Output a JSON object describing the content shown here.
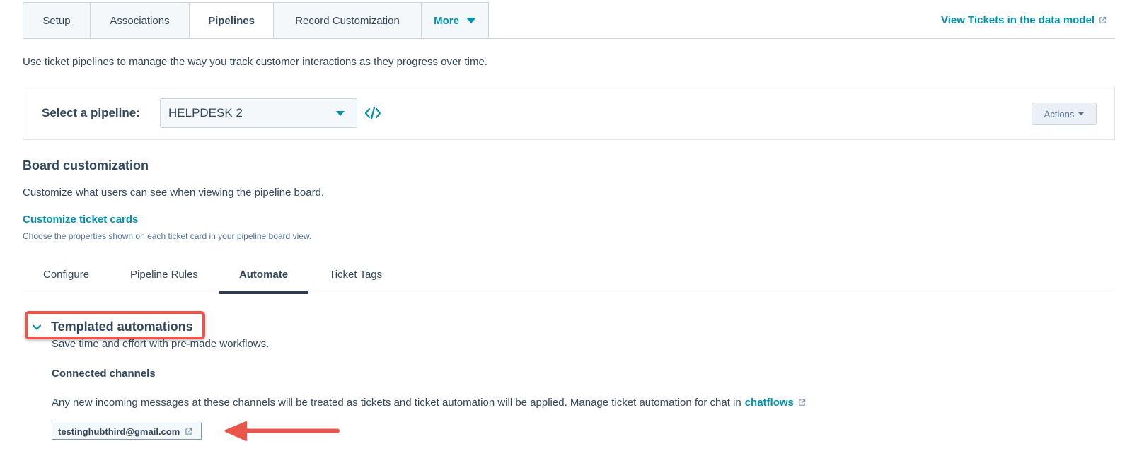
{
  "top_tabs": [
    {
      "label": "Setup"
    },
    {
      "label": "Associations"
    },
    {
      "label": "Pipelines",
      "active": true
    },
    {
      "label": "Record Customization"
    },
    {
      "label": "More"
    }
  ],
  "data_model_link": "View Tickets in the data model",
  "intro": "Use ticket pipelines to manage the way you track customer interactions as they progress over time.",
  "pipeline": {
    "label": "Select a pipeline:",
    "selected": "HELPDESK 2",
    "actions_label": "Actions"
  },
  "board": {
    "title": "Board customization",
    "description": "Customize what users can see when viewing the pipeline board.",
    "customize_link": "Customize ticket cards",
    "customize_desc": "Choose the properties shown on each ticket card in your pipeline board view."
  },
  "sub_tabs": [
    {
      "label": "Configure"
    },
    {
      "label": "Pipeline Rules"
    },
    {
      "label": "Automate",
      "active": true
    },
    {
      "label": "Ticket Tags"
    }
  ],
  "templated": {
    "title": "Templated automations",
    "description": "Save time and effort with pre-made workflows."
  },
  "channels": {
    "title": "Connected channels",
    "description": "Any new incoming messages at these channels will be treated as tickets and ticket automation will be applied. Manage ticket automation for chat in",
    "chatflows_link": "chatflows",
    "email": "testinghubthird@gmail.com"
  },
  "colors": {
    "accent": "#0091ae",
    "text": "#33475b",
    "highlight": "#e8564c"
  },
  "icons": {
    "more_caret": "caret-down-icon",
    "external_link": "external-link-icon",
    "embed": "code-embed-icon",
    "collapse": "chevron-down-icon",
    "annotation_arrow": "arrow-left-icon"
  }
}
